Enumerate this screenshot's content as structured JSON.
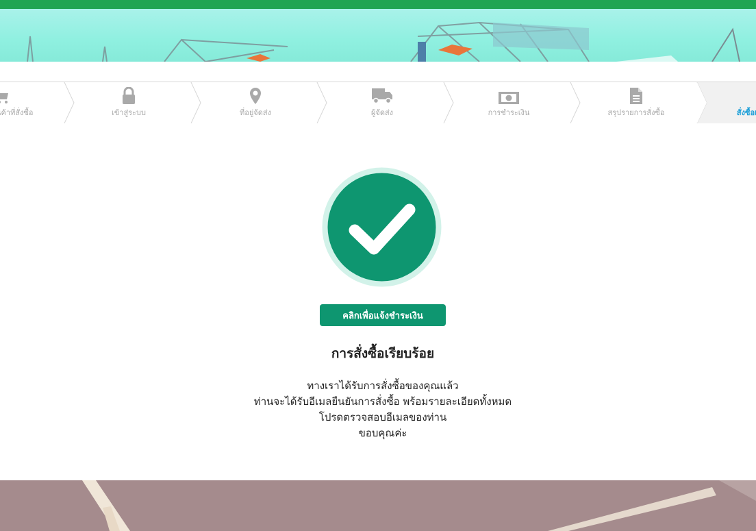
{
  "steps": [
    {
      "label": "ตะกร้าสินค้าที่สั่งซื้อ",
      "icon": "cart-icon"
    },
    {
      "label": "เข้าสู่ระบบ",
      "icon": "lock-icon"
    },
    {
      "label": "ที่อยู่จัดส่ง",
      "icon": "map-pin-icon"
    },
    {
      "label": "ผู้จัดส่ง",
      "icon": "truck-icon"
    },
    {
      "label": "การชำระเงิน",
      "icon": "money-icon"
    },
    {
      "label": "สรุปรายการสั่งซื้อ",
      "icon": "document-icon"
    },
    {
      "label": "สั่งซื้อเรียบร้อย",
      "icon": "check-icon",
      "active": true
    }
  ],
  "main": {
    "pay_button": "คลิกเพื่อแจ้งชำระเงิน",
    "title": "การสั่งซื้อเรียบร้อย",
    "message_lines": [
      "ทางเราได้รับการสั่งซื้อของคุณแล้ว",
      "ท่านจะได้รับอีเมลยืนยันการสั่งซื้อ พร้อมรายละเอียดทั้งหมด",
      "โปรดตรวจสอบอีเมลของท่าน",
      "ขอบคุณค่ะ"
    ]
  },
  "colors": {
    "topbar": "#1fa553",
    "success_green": "#0e9670",
    "success_ring": "#d2f2e9",
    "active_step_text": "#1c9fd8",
    "inactive_step_text": "#a9a9a9"
  }
}
